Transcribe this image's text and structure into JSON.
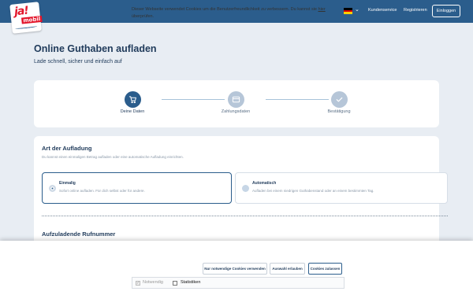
{
  "header": {
    "logo": {
      "text_top": "ja!",
      "text_bottom": "mobil",
      "brand_color": "#e3162b"
    },
    "language": {
      "flag": "de-flag-icon",
      "chevron": "chevron-down-icon"
    },
    "links": {
      "customer_service": "Kundenservice",
      "register": "Registrieren",
      "login": "Einloggen"
    },
    "bar_color": "#2b5d8c"
  },
  "page": {
    "title": "Online Guthaben aufladen",
    "subtitle": "Lade schnell, sicher und einfach auf"
  },
  "stepper": {
    "steps": [
      {
        "label": "Deine Daten",
        "icon": "cart-icon",
        "active": true
      },
      {
        "label": "Zahlungsdaten",
        "icon": "credit-card-icon",
        "active": false
      },
      {
        "label": "Bestätigung",
        "icon": "check-icon",
        "active": false
      }
    ]
  },
  "recharge_type": {
    "title": "Art der Aufladung",
    "description": "Du kannst einen einmaligen Betrag aufladen oder eine automatische Aufladung einrichten.",
    "options": [
      {
        "title": "Einmalig",
        "description": "Sofort online aufladen. Für dich selbst oder für andere.",
        "selected": true
      },
      {
        "title": "Automatisch",
        "description": "Aufladen bei einem niedrigen Guthabenstand oder an einem bestimmten Tag.",
        "selected": false
      }
    ]
  },
  "phone_section": {
    "title": "Aufzuladende Rufnummer"
  },
  "cookie_banner": {
    "text_before": "Dieser Webseite verwendet Cookies um die Benutzerfreundlichkeit zu verbessern. Du kannst sie ",
    "link": "hier",
    "text_after": " überprüfen.",
    "buttons": {
      "necessary_only": "Nur notwendige Cookies verwenden",
      "allow_selection": "Auswahl erlauben",
      "allow_all": "Cookies zulassen"
    },
    "checkboxes": [
      {
        "label": "Notwendig",
        "checked": true,
        "disabled": true
      },
      {
        "label": "Statistiken",
        "checked": false,
        "disabled": false
      }
    ]
  }
}
